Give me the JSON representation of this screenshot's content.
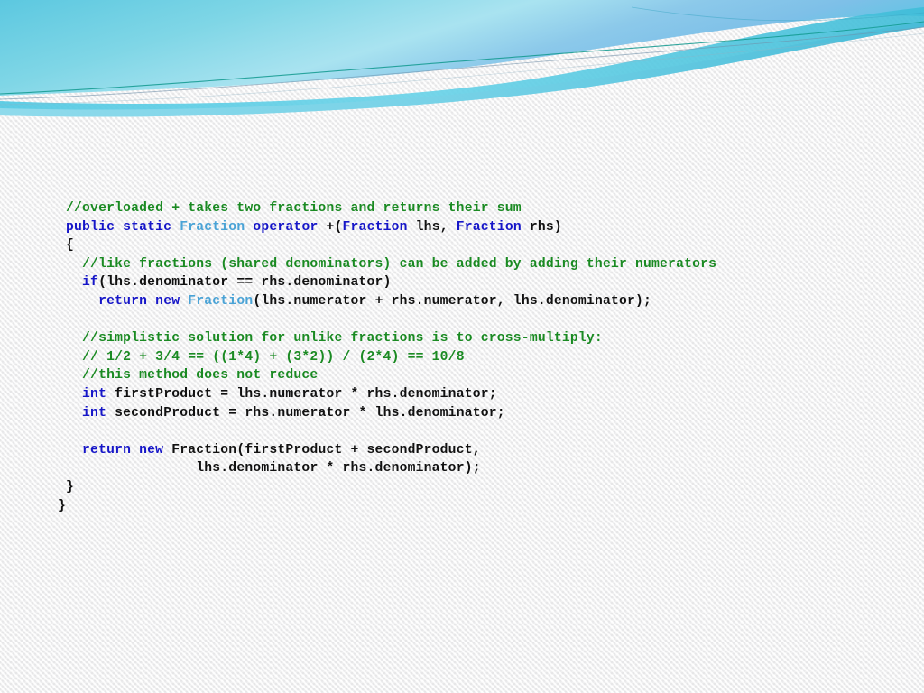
{
  "slide": {
    "background_color": "#f5f5f5",
    "banner": {
      "name": "decorative-wave-banner",
      "gradient_cyan": "#5cc8e0",
      "gradient_light_cyan": "#a9e3f0",
      "gradient_blue": "#7ec0e8",
      "accent_line_teal": "#11998e",
      "accent_line_steel": "#6f8fa8"
    },
    "syntax_colors": {
      "comment": "#1a8a22",
      "keyword": "#1616c8",
      "type": "#4aa3d6",
      "plain": "#111111"
    }
  },
  "code": {
    "language": "csharp",
    "lines": [
      {
        "indent": 1,
        "tokens": [
          {
            "t": "cmt",
            "s": "//overloaded + takes two fractions and returns their sum"
          }
        ]
      },
      {
        "indent": 1,
        "tokens": [
          {
            "t": "kw",
            "s": "public static "
          },
          {
            "t": "type",
            "s": "Fraction "
          },
          {
            "t": "kw",
            "s": "operator "
          },
          {
            "t": "txt",
            "s": "+("
          },
          {
            "t": "kw",
            "s": "Fraction"
          },
          {
            "t": "txt",
            "s": " lhs, "
          },
          {
            "t": "kw",
            "s": "Fraction"
          },
          {
            "t": "txt",
            "s": " rhs)"
          }
        ]
      },
      {
        "indent": 1,
        "tokens": [
          {
            "t": "txt",
            "s": "{"
          }
        ]
      },
      {
        "indent": 3,
        "tokens": [
          {
            "t": "cmt",
            "s": "//like fractions (shared denominators) can be added by adding their numerators"
          }
        ]
      },
      {
        "indent": 3,
        "tokens": [
          {
            "t": "kw",
            "s": "if"
          },
          {
            "t": "txt",
            "s": "(lhs.denominator == rhs.denominator)"
          }
        ]
      },
      {
        "indent": 5,
        "tokens": [
          {
            "t": "kw",
            "s": "return new "
          },
          {
            "t": "type",
            "s": "Fraction"
          },
          {
            "t": "txt",
            "s": "(lhs.numerator + rhs.numerator, lhs.denominator);"
          }
        ]
      },
      {
        "indent": 0,
        "blank": true,
        "tokens": []
      },
      {
        "indent": 3,
        "tokens": [
          {
            "t": "cmt",
            "s": "//simplistic solution for unlike fractions is to cross-multiply:"
          }
        ]
      },
      {
        "indent": 3,
        "tokens": [
          {
            "t": "cmt",
            "s": "// 1/2 + 3/4 == ((1*4) + (3*2)) / (2*4) == 10/8"
          }
        ]
      },
      {
        "indent": 3,
        "tokens": [
          {
            "t": "cmt",
            "s": "//this method does not reduce"
          }
        ]
      },
      {
        "indent": 3,
        "tokens": [
          {
            "t": "kw",
            "s": "int"
          },
          {
            "t": "txt",
            "s": " firstProduct = lhs.numerator * rhs.denominator;"
          }
        ]
      },
      {
        "indent": 3,
        "tokens": [
          {
            "t": "kw",
            "s": "int"
          },
          {
            "t": "txt",
            "s": " secondProduct = rhs.numerator * lhs.denominator;"
          }
        ]
      },
      {
        "indent": 0,
        "blank": true,
        "tokens": []
      },
      {
        "indent": 3,
        "tokens": [
          {
            "t": "kw",
            "s": "return new "
          },
          {
            "t": "txt",
            "s": "Fraction(firstProduct + secondProduct,"
          }
        ]
      },
      {
        "indent": 17,
        "tokens": [
          {
            "t": "txt",
            "s": "lhs.denominator * rhs.denominator);"
          }
        ]
      },
      {
        "indent": 1,
        "tokens": [
          {
            "t": "txt",
            "s": "}"
          }
        ]
      },
      {
        "indent": 0,
        "tokens": [
          {
            "t": "txt",
            "s": "}"
          }
        ]
      }
    ]
  }
}
